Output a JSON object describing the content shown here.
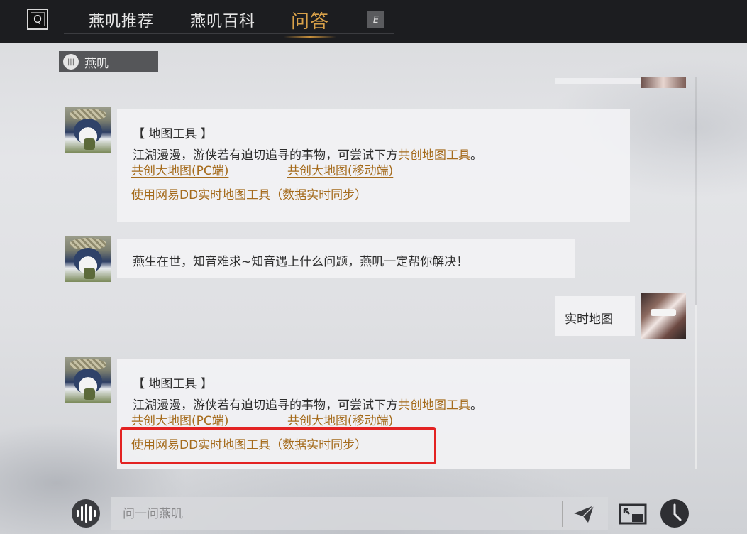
{
  "topbar": {
    "left_key": "Q",
    "tabs": [
      {
        "label": "燕叽推荐"
      },
      {
        "label": "燕叽百科"
      },
      {
        "label": "问答"
      }
    ],
    "right_key": "E"
  },
  "sender_chip": {
    "label": "燕叽"
  },
  "messages": [
    {
      "title": "【 地图工具 】",
      "text_prefix": "江湖漫漫，游侠若有迫切追寻的事物，可尝试下方",
      "text_highlight": "共创地图工具",
      "text_suffix": "。",
      "link_pc": "共创大地图(PC端)",
      "link_mobile": "共创大地图(移动端)",
      "link_dd": "使用网易DD实时地图工具（数据实时同步）"
    },
    {
      "text": "燕生在世，知音难求~知音遇上什么问题，燕叽一定帮你解决！"
    },
    {
      "text": "实时地图"
    },
    {
      "title": "【 地图工具 】",
      "text_prefix": "江湖漫漫，游侠若有迫切追寻的事物，可尝试下方",
      "text_highlight": "共创地图工具",
      "text_suffix": "。",
      "link_pc": "共创大地图(PC端)",
      "link_mobile": "共创大地图(移动端)",
      "link_dd": "使用网易DD实时地图工具（数据实时同步）"
    }
  ],
  "input": {
    "placeholder": "问一问燕叽"
  },
  "colors": {
    "accent": "#d9a24a",
    "link": "#a56b1c",
    "highlight_box": "#e32222"
  }
}
